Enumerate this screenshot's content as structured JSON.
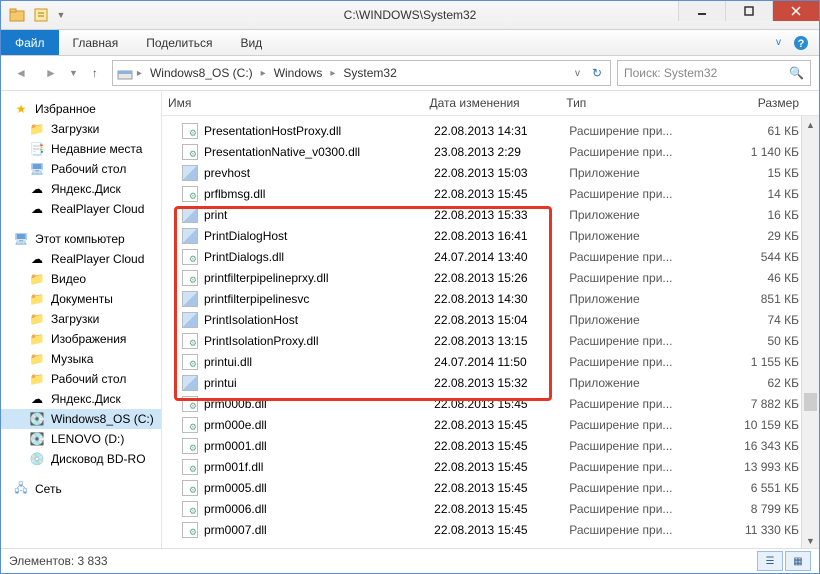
{
  "window": {
    "title": "C:\\WINDOWS\\System32"
  },
  "tabs": {
    "file": "Файл",
    "home": "Главная",
    "share": "Поделиться",
    "view": "Вид"
  },
  "breadcrumb": {
    "segments": [
      "Windows8_OS (C:)",
      "Windows",
      "System32"
    ]
  },
  "search": {
    "placeholder": "Поиск: System32"
  },
  "sidebar": {
    "favorites": {
      "label": "Избранное",
      "items": [
        "Загрузки",
        "Недавние места",
        "Рабочий стол",
        "Яндекс.Диск",
        "RealPlayer Cloud"
      ]
    },
    "computer": {
      "label": "Этот компьютер",
      "items": [
        "RealPlayer Cloud",
        "Видео",
        "Документы",
        "Загрузки",
        "Изображения",
        "Музыка",
        "Рабочий стол",
        "Яндекс.Диск",
        "Windows8_OS (C:)",
        "LENOVO (D:)",
        "Дисковод BD-RO"
      ]
    },
    "network": {
      "label": "Сеть"
    }
  },
  "columns": {
    "name": "Имя",
    "date": "Дата изменения",
    "type": "Тип",
    "size": "Размер"
  },
  "files": [
    {
      "icon": "dll",
      "name": "PresentationHostProxy.dll",
      "date": "22.08.2013 14:31",
      "type": "Расширение при...",
      "size": "61 КБ"
    },
    {
      "icon": "dll",
      "name": "PresentationNative_v0300.dll",
      "date": "23.08.2013 2:29",
      "type": "Расширение при...",
      "size": "1 140 КБ"
    },
    {
      "icon": "exe",
      "name": "prevhost",
      "date": "22.08.2013 15:03",
      "type": "Приложение",
      "size": "15 КБ"
    },
    {
      "icon": "dll",
      "name": "prflbmsg.dll",
      "date": "22.08.2013 15:45",
      "type": "Расширение при...",
      "size": "14 КБ"
    },
    {
      "icon": "exe",
      "name": "print",
      "date": "22.08.2013 15:33",
      "type": "Приложение",
      "size": "16 КБ"
    },
    {
      "icon": "exe",
      "name": "PrintDialogHost",
      "date": "22.08.2013 16:41",
      "type": "Приложение",
      "size": "29 КБ"
    },
    {
      "icon": "dll",
      "name": "PrintDialogs.dll",
      "date": "24.07.2014 13:40",
      "type": "Расширение при...",
      "size": "544 КБ"
    },
    {
      "icon": "dll",
      "name": "printfilterpipelineprxy.dll",
      "date": "22.08.2013 15:26",
      "type": "Расширение при...",
      "size": "46 КБ"
    },
    {
      "icon": "exe",
      "name": "printfilterpipelinesvc",
      "date": "22.08.2013 14:30",
      "type": "Приложение",
      "size": "851 КБ"
    },
    {
      "icon": "exe",
      "name": "PrintIsolationHost",
      "date": "22.08.2013 15:04",
      "type": "Приложение",
      "size": "74 КБ"
    },
    {
      "icon": "dll",
      "name": "PrintIsolationProxy.dll",
      "date": "22.08.2013 13:15",
      "type": "Расширение при...",
      "size": "50 КБ"
    },
    {
      "icon": "dll",
      "name": "printui.dll",
      "date": "24.07.2014 11:50",
      "type": "Расширение при...",
      "size": "1 155 КБ"
    },
    {
      "icon": "exe",
      "name": "printui",
      "date": "22.08.2013 15:32",
      "type": "Приложение",
      "size": "62 КБ"
    },
    {
      "icon": "dll",
      "name": "prm000b.dll",
      "date": "22.08.2013 15:45",
      "type": "Расширение при...",
      "size": "7 882 КБ"
    },
    {
      "icon": "dll",
      "name": "prm000e.dll",
      "date": "22.08.2013 15:45",
      "type": "Расширение при...",
      "size": "10 159 КБ"
    },
    {
      "icon": "dll",
      "name": "prm0001.dll",
      "date": "22.08.2013 15:45",
      "type": "Расширение при...",
      "size": "16 343 КБ"
    },
    {
      "icon": "dll",
      "name": "prm001f.dll",
      "date": "22.08.2013 15:45",
      "type": "Расширение при...",
      "size": "13 993 КБ"
    },
    {
      "icon": "dll",
      "name": "prm0005.dll",
      "date": "22.08.2013 15:45",
      "type": "Расширение при...",
      "size": "6 551 КБ"
    },
    {
      "icon": "dll",
      "name": "prm0006.dll",
      "date": "22.08.2013 15:45",
      "type": "Расширение при...",
      "size": "8 799 КБ"
    },
    {
      "icon": "dll",
      "name": "prm0007.dll",
      "date": "22.08.2013 15:45",
      "type": "Расширение при...",
      "size": "11 330 КБ"
    }
  ],
  "status": {
    "count_label": "Элементов:",
    "count": "3 833"
  }
}
